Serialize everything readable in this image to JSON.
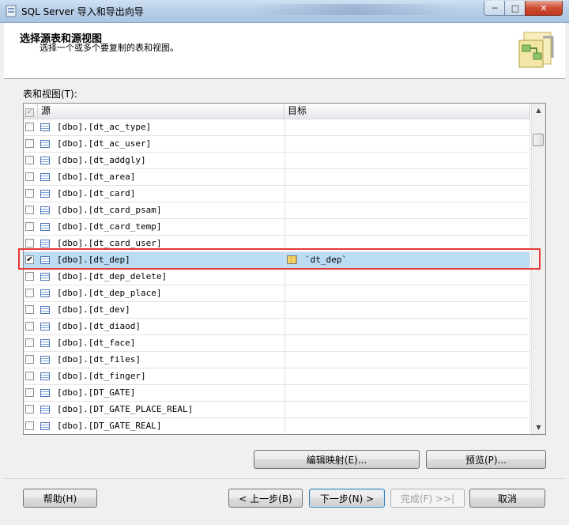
{
  "window": {
    "title": "SQL Server 导入和导出向导",
    "controls": {
      "minimize": "─",
      "maximize": "□",
      "close": "✕"
    }
  },
  "header": {
    "title": "选择源表和源视图",
    "subtitle": "选择一个或多个要复制的表和视图。"
  },
  "list": {
    "label": "表和视图(T):",
    "columns": {
      "source": "源",
      "destination": "目标"
    },
    "rows": [
      {
        "source": "[dbo].[dt_ac_type]",
        "checked": false,
        "destination": ""
      },
      {
        "source": "[dbo].[dt_ac_user]",
        "checked": false,
        "destination": ""
      },
      {
        "source": "[dbo].[dt_addgly]",
        "checked": false,
        "destination": ""
      },
      {
        "source": "[dbo].[dt_area]",
        "checked": false,
        "destination": ""
      },
      {
        "source": "[dbo].[dt_card]",
        "checked": false,
        "destination": ""
      },
      {
        "source": "[dbo].[dt_card_psam]",
        "checked": false,
        "destination": ""
      },
      {
        "source": "[dbo].[dt_card_temp]",
        "checked": false,
        "destination": ""
      },
      {
        "source": "[dbo].[dt_card_user]",
        "checked": false,
        "destination": ""
      },
      {
        "source": "[dbo].[dt_dep]",
        "checked": true,
        "destination": "`dt_dep`"
      },
      {
        "source": "[dbo].[dt_dep_delete]",
        "checked": false,
        "destination": ""
      },
      {
        "source": "[dbo].[dt_dep_place]",
        "checked": false,
        "destination": ""
      },
      {
        "source": "[dbo].[dt_dev]",
        "checked": false,
        "destination": ""
      },
      {
        "source": "[dbo].[dt_diaod]",
        "checked": false,
        "destination": ""
      },
      {
        "source": "[dbo].[dt_face]",
        "checked": false,
        "destination": ""
      },
      {
        "source": "[dbo].[dt_files]",
        "checked": false,
        "destination": ""
      },
      {
        "source": "[dbo].[dt_finger]",
        "checked": false,
        "destination": ""
      },
      {
        "source": "[dbo].[DT_GATE]",
        "checked": false,
        "destination": ""
      },
      {
        "source": "[dbo].[DT_GATE_PLACE_REAL]",
        "checked": false,
        "destination": ""
      },
      {
        "source": "[dbo].[DT_GATE_REAL]",
        "checked": false,
        "destination": ""
      }
    ]
  },
  "buttons": {
    "edit_mappings": "编辑映射(E)...",
    "preview": "预览(P)...",
    "help": "帮助(H)",
    "back": "< 上一步(B)",
    "next": "下一步(N) >",
    "finish": "完成(F) >>|",
    "cancel": "取消"
  },
  "icons": {
    "app": "sql-wizard-app-icon",
    "wizard": "table-copy-wizard-icon",
    "source_row": "table-icon",
    "destination_row": "destination-table-icon"
  },
  "colors": {
    "selected_row": "#bcdcf4",
    "highlight_box": "#e53935"
  }
}
